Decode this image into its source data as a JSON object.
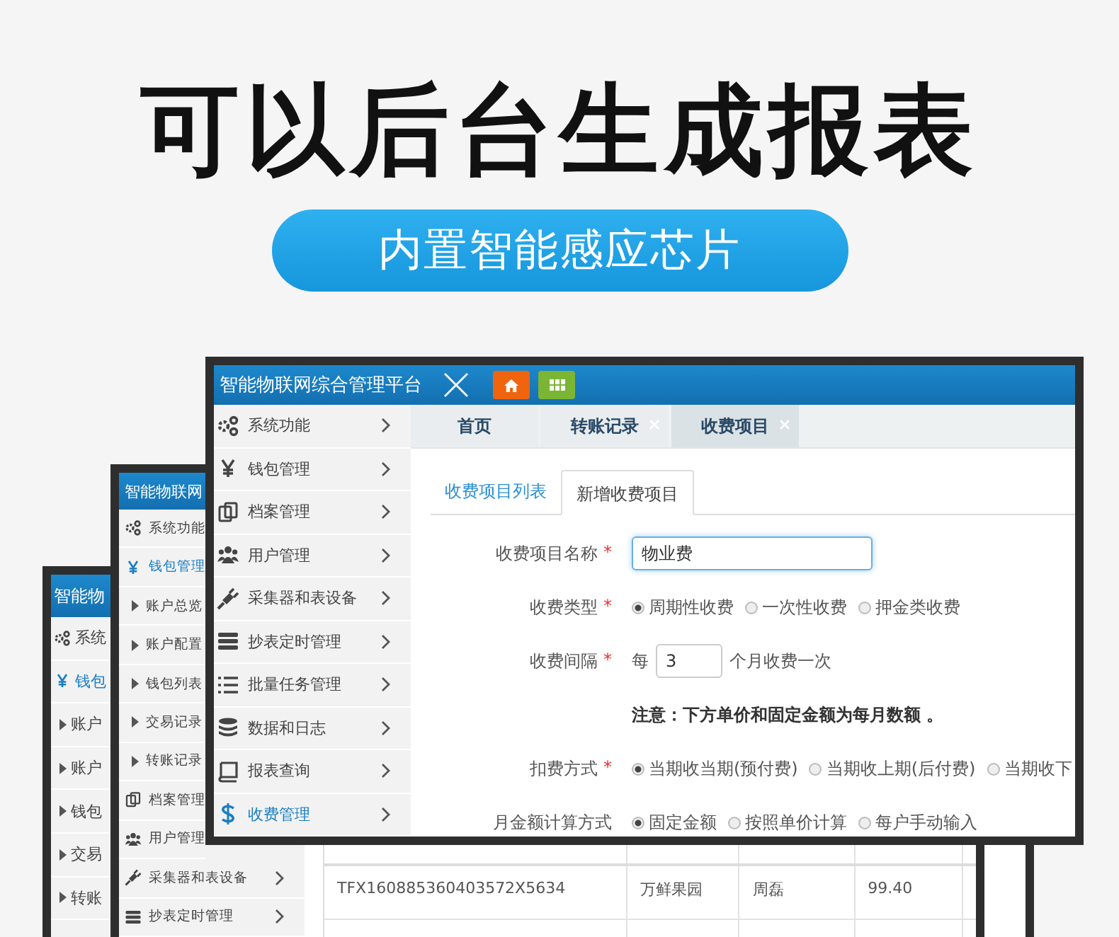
{
  "headline": "可以后台生成报表",
  "badge": "内置智能感应芯片",
  "back_window": {
    "title": "智能物",
    "sidebar": [
      {
        "label": "系统",
        "kind": "menu",
        "selected": false
      },
      {
        "label": "钱包",
        "kind": "menu",
        "selected": true
      },
      {
        "label": "账户",
        "kind": "sub",
        "selected": false
      },
      {
        "label": "账户",
        "kind": "sub",
        "selected": false
      },
      {
        "label": "钱包",
        "kind": "sub",
        "selected": false
      },
      {
        "label": "交易",
        "kind": "sub",
        "selected": false
      },
      {
        "label": "转账",
        "kind": "sub",
        "selected": false
      }
    ]
  },
  "middle_window": {
    "title": "智能物联网",
    "sidebar": [
      {
        "label": "系统功能",
        "kind": "menu",
        "selected": false
      },
      {
        "label": "钱包管理",
        "kind": "menu",
        "selected": true
      },
      {
        "label": "账户总览",
        "kind": "sub",
        "selected": false
      },
      {
        "label": "账户配置",
        "kind": "sub",
        "selected": false
      },
      {
        "label": "钱包列表",
        "kind": "sub",
        "selected": false
      },
      {
        "label": "交易记录",
        "kind": "sub",
        "selected": false
      },
      {
        "label": "转账记录",
        "kind": "sub",
        "selected": false
      },
      {
        "label": "档案管理",
        "kind": "menu",
        "selected": false
      },
      {
        "label": "用户管理",
        "kind": "menu",
        "selected": false
      },
      {
        "label": "采集器和表设备",
        "kind": "menu",
        "selected": false
      },
      {
        "label": "抄表定时管理",
        "kind": "menu",
        "selected": false
      }
    ],
    "table": {
      "rows": [
        [
          "TFX160885360403572X5634",
          "万鲜果园",
          "周磊",
          "99.40"
        ]
      ]
    }
  },
  "front_window": {
    "title": "智能物联网综合管理平台",
    "sidebar": [
      {
        "label": "系统功能",
        "kind": "menu",
        "selected": false
      },
      {
        "label": "钱包管理",
        "kind": "menu",
        "selected": false
      },
      {
        "label": "档案管理",
        "kind": "menu",
        "selected": false
      },
      {
        "label": "用户管理",
        "kind": "menu",
        "selected": false
      },
      {
        "label": "采集器和表设备",
        "kind": "menu",
        "selected": false
      },
      {
        "label": "抄表定时管理",
        "kind": "menu",
        "selected": false
      },
      {
        "label": "批量任务管理",
        "kind": "menu",
        "selected": false
      },
      {
        "label": "数据和日志",
        "kind": "menu",
        "selected": false
      },
      {
        "label": "报表查询",
        "kind": "menu",
        "selected": false
      },
      {
        "label": "收费管理",
        "kind": "menu",
        "selected": true
      }
    ],
    "tabs": [
      {
        "label": "首页",
        "closable": false,
        "selected": false
      },
      {
        "label": "转账记录",
        "closable": true,
        "selected": false
      },
      {
        "label": "收费项目",
        "closable": true,
        "selected": true
      }
    ],
    "sub_tabs": [
      {
        "label": "收费项目列表",
        "selected": false
      },
      {
        "label": "新增收费项目",
        "selected": true
      }
    ],
    "form": [
      {
        "kind": "text",
        "label": "收费项目名称",
        "required_mark": "*",
        "value": "物业费",
        "focused": true
      },
      {
        "kind": "radio",
        "label": "收费类型",
        "required_mark": "*",
        "options": [
          {
            "label": "周期性收费",
            "selected": true
          },
          {
            "label": "一次性收费",
            "selected": false
          },
          {
            "label": "押金类收费",
            "selected": false
          }
        ]
      },
      {
        "kind": "interval",
        "label": "收费间隔",
        "required_mark": "*",
        "prefix": "每",
        "value": "3",
        "suffix": "个月收费一次"
      },
      {
        "kind": "note",
        "text": "注意：下方单价和固定金额为每月数额 。"
      },
      {
        "kind": "radio",
        "label": "扣费方式",
        "required_mark": "*",
        "options": [
          {
            "label": "当期收当期(预付费)",
            "selected": true
          },
          {
            "label": "当期收上期(后付费)",
            "selected": false
          },
          {
            "label": "当期收下",
            "selected": false
          }
        ]
      },
      {
        "kind": "radio",
        "label": "月金额计算方式",
        "options": [
          {
            "label": "固定金额",
            "selected": true
          },
          {
            "label": "按照单价计算",
            "selected": false
          },
          {
            "label": "每户手动输入",
            "selected": false
          }
        ]
      }
    ]
  }
}
